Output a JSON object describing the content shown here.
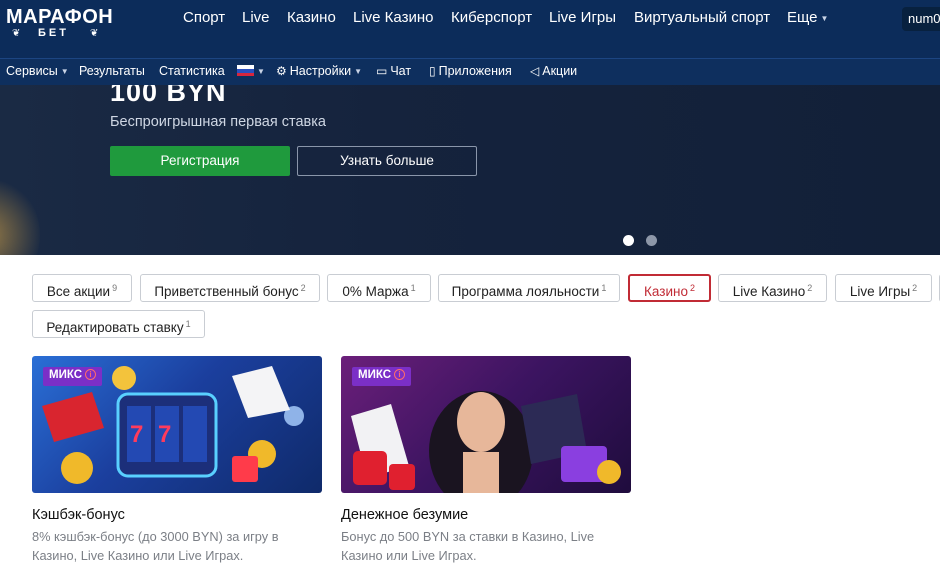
{
  "header": {
    "logo_top": "МАРАФОН",
    "logo_bottom": "БЕТ",
    "nav": [
      "Спорт",
      "Live",
      "Казино",
      "Live Казино",
      "Киберспорт",
      "Live Игры",
      "Виртуальный спорт",
      "Еще"
    ],
    "user_chip": "num0"
  },
  "subnav": {
    "services": "Сервисы",
    "results": "Результаты",
    "stats": "Статистика",
    "settings": "Настройки",
    "chat": "Чат",
    "apps": "Приложения",
    "promos": "Акции"
  },
  "hero": {
    "amount": "100 BYN",
    "subtitle": "Беспроигрышная первая ставка",
    "register_label": "Регистрация",
    "more_label": "Узнать больше"
  },
  "filters": [
    {
      "label": "Все акции",
      "count": "9"
    },
    {
      "label": "Приветственный бонус",
      "count": "2"
    },
    {
      "label": "0% Маржа",
      "count": "1"
    },
    {
      "label": "Программа лояльности",
      "count": "1"
    },
    {
      "label": "Казино",
      "count": "2"
    },
    {
      "label": "Live Казино",
      "count": "2"
    },
    {
      "label": "Live Игры",
      "count": "2"
    },
    {
      "label": "Редактировать ставку",
      "count": "1"
    }
  ],
  "cards": [
    {
      "badge": "МИКС",
      "title": "Кэшбэк-бонус",
      "desc": "8% кэшбэк-бонус (до 3000 BYN) за игру в Казино, Live Казино или Live Играх."
    },
    {
      "badge": "МИКС",
      "title": "Денежное безумие",
      "desc": "Бонус до 500 BYN за ставки в Казино, Live Казино или Live Играх."
    }
  ],
  "colors": {
    "header_bg": "#0c2c5a",
    "accent_green": "#1f9a3d",
    "active_red": "#c12b35",
    "badge_purple": "#7b2fc7"
  }
}
